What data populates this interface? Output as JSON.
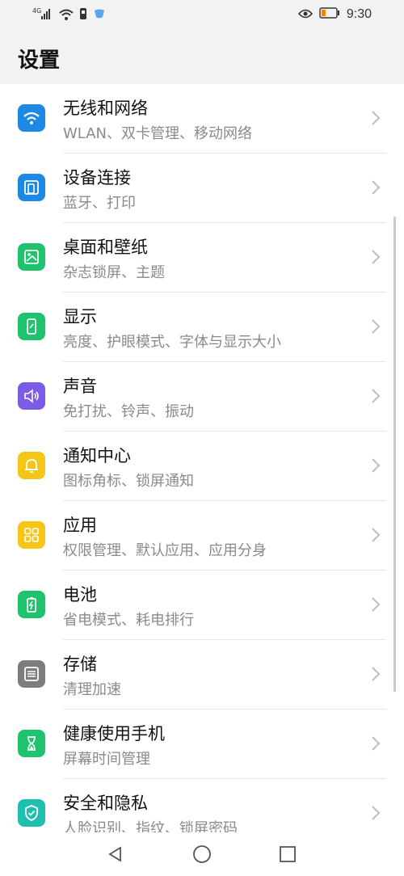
{
  "status_bar": {
    "signal_text": "4G",
    "time": "9:30",
    "icons": [
      "signal-icon",
      "wifi-icon",
      "sim-icon",
      "notification-icon",
      "eye-comfort-icon",
      "battery-icon"
    ]
  },
  "header": {
    "title": "设置"
  },
  "settings": [
    {
      "title": "无线和网络",
      "subtitle": "WLAN、双卡管理、移动网络",
      "icon": "wifi-icon",
      "color": "#1e88e5"
    },
    {
      "title": "设备连接",
      "subtitle": "蓝牙、打印",
      "icon": "device-connection-icon",
      "color": "#1e88e5"
    },
    {
      "title": "桌面和壁纸",
      "subtitle": "杂志锁屏、主题",
      "icon": "wallpaper-icon",
      "color": "#20c36d"
    },
    {
      "title": "显示",
      "subtitle": "亮度、护眼模式、字体与显示大小",
      "icon": "display-icon",
      "color": "#20c36d"
    },
    {
      "title": "声音",
      "subtitle": "免打扰、铃声、振动",
      "icon": "sound-icon",
      "color": "#7c5ce6"
    },
    {
      "title": "通知中心",
      "subtitle": "图标角标、锁屏通知",
      "icon": "bell-icon",
      "color": "#f5c518"
    },
    {
      "title": "应用",
      "subtitle": "权限管理、默认应用、应用分身",
      "icon": "apps-icon",
      "color": "#f5c518"
    },
    {
      "title": "电池",
      "subtitle": "省电模式、耗电排行",
      "icon": "battery-icon",
      "color": "#20c36d"
    },
    {
      "title": "存储",
      "subtitle": "清理加速",
      "icon": "storage-icon",
      "color": "#7d7d7d"
    },
    {
      "title": "健康使用手机",
      "subtitle": "屏幕时间管理",
      "icon": "hourglass-icon",
      "color": "#20c36d"
    },
    {
      "title": "安全和隐私",
      "subtitle": "人脸识别、指纹、锁屏密码",
      "icon": "shield-icon",
      "color": "#1fbfb0"
    }
  ],
  "navigation": {
    "back": "back-icon",
    "home": "home-icon",
    "recents": "recents-icon"
  }
}
